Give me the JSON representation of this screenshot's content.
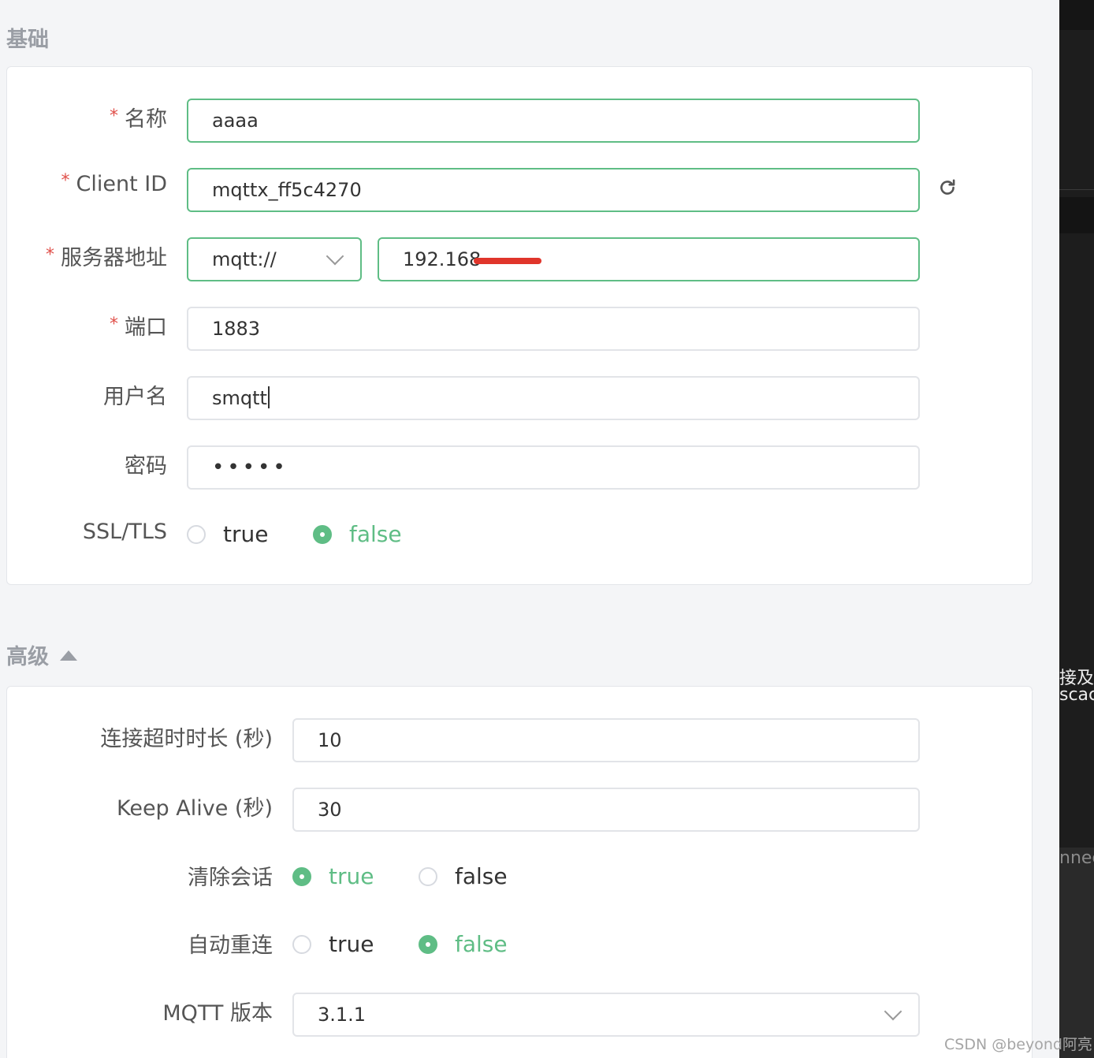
{
  "basic": {
    "title": "基础",
    "name": {
      "label": "名称",
      "value": "aaaa"
    },
    "client_id": {
      "label": "Client ID",
      "value": "mqttx_ff5c4270"
    },
    "host": {
      "label": "服务器地址",
      "protocol": "mqtt://",
      "value": "192.168"
    },
    "port": {
      "label": "端口",
      "value": "1883"
    },
    "username": {
      "label": "用户名",
      "value": "smqtt"
    },
    "password": {
      "label": "密码",
      "masked": "•••••"
    },
    "ssl": {
      "label": "SSL/TLS",
      "options": [
        "true",
        "false"
      ],
      "selected": "false"
    }
  },
  "advanced": {
    "title": "高级",
    "connect_timeout": {
      "label": "连接超时时长 (秒)",
      "value": "10"
    },
    "keep_alive": {
      "label": "Keep Alive (秒)",
      "value": "30"
    },
    "clean_session": {
      "label": "清除会话",
      "options": [
        "true",
        "false"
      ],
      "selected": "true"
    },
    "auto_reconnect": {
      "label": "自动重连",
      "options": [
        "true",
        "false"
      ],
      "selected": "false"
    },
    "mqtt_version": {
      "label": "MQTT 版本",
      "value": "3.1.1"
    }
  },
  "side_panel": {
    "text1": "接及",
    "text2": "scac",
    "text3": "nnec"
  },
  "watermark": "CSDN @beyond阿亮",
  "colors": {
    "accent": "#5fbd85",
    "required": "#e0504a",
    "redaction": "#e0352b"
  }
}
